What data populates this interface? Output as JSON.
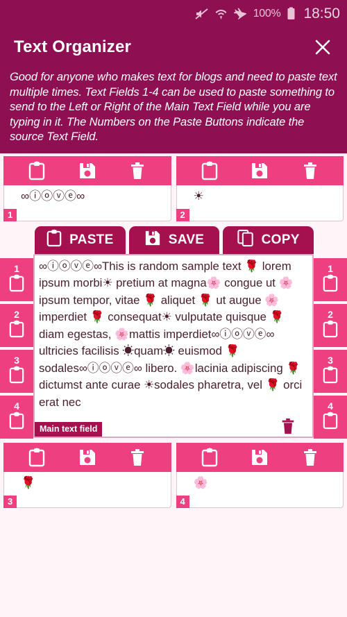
{
  "status_bar": {
    "icons": [
      "mute-icon",
      "wifi-icon",
      "airplane-mode-icon",
      "battery-icon"
    ],
    "battery_label": "100%",
    "time": "18:50"
  },
  "app_bar": {
    "title": "Text Organizer",
    "close_label": "✕"
  },
  "description": "Good for anyone who makes text for blogs and need to paste text multiple times. Text Fields 1-4 can be used to paste something to send to the Left or Right of the Main Text Field while you are typing in it. The Numbers on the Paste Buttons indicate the source Text Field.",
  "colors": {
    "header": "#8e1053",
    "toolbar_pink": "#ee4080",
    "tab_magenta": "#a5104f",
    "page_background": "#fff5f8",
    "field_background": "#ffffff",
    "text": "#4a2030"
  },
  "card_toolbar": {
    "paste_label": "paste-icon",
    "save_label": "save-icon",
    "delete_label": "delete-icon"
  },
  "text_fields": [
    {
      "number": "1",
      "value": "∞ⓘⓞⓥⓔ∞"
    },
    {
      "number": "2",
      "value": "☀"
    },
    {
      "number": "3",
      "value": "🌹"
    },
    {
      "number": "4",
      "value": "🌸"
    }
  ],
  "main_editor": {
    "tabs": [
      {
        "label": "PASTE",
        "icon": "clipboard-icon"
      },
      {
        "label": "SAVE",
        "icon": "floppy-disk-icon"
      },
      {
        "label": "COPY",
        "icon": "copy-icon"
      }
    ],
    "field_label": "Main text field",
    "trash_icon": "delete-icon",
    "value": "∞ⓘⓞⓥⓔ∞This is random sample text 🌹 lorem ipsum morbi☀ pretium at magna🌸 congue ut 🌸ipsum tempor, vitae 🌹 aliquet 🌹 ut augue 🌸imperdiet 🌹 consequat☀ vulputate quisque 🌹 diam egestas, 🌸mattis imperdiet∞ⓘⓞⓥⓔ∞ ultricies facilisis ☀quam☀ euismod 🌹 sodales∞ⓘⓞⓥⓔ∞ libero. 🌸lacinia adipiscing 🌹 dictumst ante curae ☀sodales pharetra, vel 🌹 orci erat nec"
  },
  "paste_buttons_left": [
    {
      "number": "1"
    },
    {
      "number": "2"
    },
    {
      "number": "3"
    },
    {
      "number": "4"
    }
  ],
  "paste_buttons_right": [
    {
      "number": "1"
    },
    {
      "number": "2"
    },
    {
      "number": "3"
    },
    {
      "number": "4"
    }
  ]
}
